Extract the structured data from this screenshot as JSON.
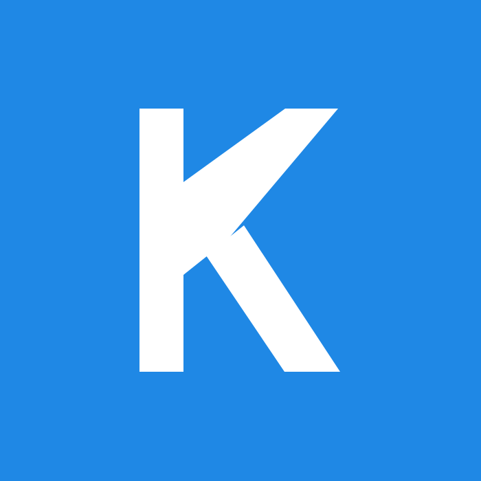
{
  "avatar": {
    "initial": "K",
    "background_color": "#1f88e5",
    "letter_color": "#ffffff"
  }
}
